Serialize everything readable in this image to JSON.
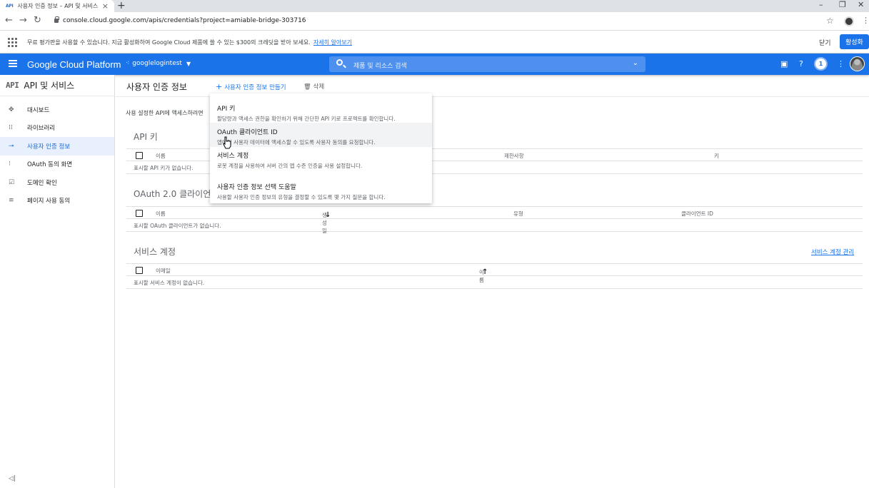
{
  "browser": {
    "tab_favicon": "API",
    "tab_title": "사용자 인증 정보 – API 및 서비스",
    "url": "console.cloud.google.com/apis/credentials?project=amiable-bridge-303716"
  },
  "banner": {
    "text": "무료 평가판을 사용할 수 있습니다. 지금 활성화하여 Google Cloud 제품에 쓸 수 있는 $300의 크레딧을 받아 보세요.",
    "link": "자세히 알아보기",
    "dismiss": "닫기",
    "activate": "활성화"
  },
  "header": {
    "title": "Google Cloud Platform",
    "project": "googlelogintest",
    "search_placeholder": "제품 및 리소스 검색",
    "notification_count": "1"
  },
  "sidebar": {
    "logo": "API",
    "title": "API 및 서비스",
    "items": [
      {
        "label": "대시보드",
        "icon": "dashboard-icon"
      },
      {
        "label": "라이브러리",
        "icon": "library-icon"
      },
      {
        "label": "사용자 인증 정보",
        "icon": "key-icon"
      },
      {
        "label": "OAuth 동의 화면",
        "icon": "consent-icon"
      },
      {
        "label": "도메인 확인",
        "icon": "domain-icon"
      },
      {
        "label": "페이지 사용 동의",
        "icon": "page-agreement-icon"
      }
    ]
  },
  "main": {
    "title": "사용자 인증 정보",
    "create_label": "사용자 인증 정보 만들기",
    "delete_label": "삭제",
    "intro": "사용 설정한 API에 액세스하려면",
    "api_keys": {
      "title": "API 키",
      "columns": [
        "이름",
        "제한사항",
        "키"
      ],
      "empty": "표시할 API 키가 없습니다."
    },
    "oauth": {
      "title": "OAuth 2.0 클라이언트",
      "columns": [
        "이름",
        "생성일",
        "유형",
        "클라이언트 ID"
      ],
      "empty": "표시할 OAuth 클라이언트가 없습니다."
    },
    "service_accounts": {
      "title": "서비스 계정",
      "manage_link": "서비스 계정 관리",
      "columns": [
        "이메일",
        "이름"
      ],
      "empty": "표시할 서비스 계정이 없습니다."
    }
  },
  "menu": {
    "items": [
      {
        "title": "API 키",
        "desc": "할당량과 액세스 권한을 확인하기 위해 간단한 API 키로 프로젝트를 확인합니다."
      },
      {
        "title": "OAuth 클라이언트 ID",
        "desc": "앱에서 사용자 데이터에 액세스할 수 있도록 사용자 동의를 요청합니다."
      },
      {
        "title": "서비스 계정",
        "desc": "로봇 계정을 사용하여 서버 간의 앱 수준 인증을 사용 설정합니다."
      },
      {
        "title": "사용자 인증 정보 선택 도움말",
        "desc": "사용할 사용자 인증 정보의 유형을 결정할 수 있도록 몇 가지 질문을 합니다."
      }
    ]
  },
  "colors": {
    "brand": "#1a73e8",
    "active_bg": "#e8f0fe"
  }
}
